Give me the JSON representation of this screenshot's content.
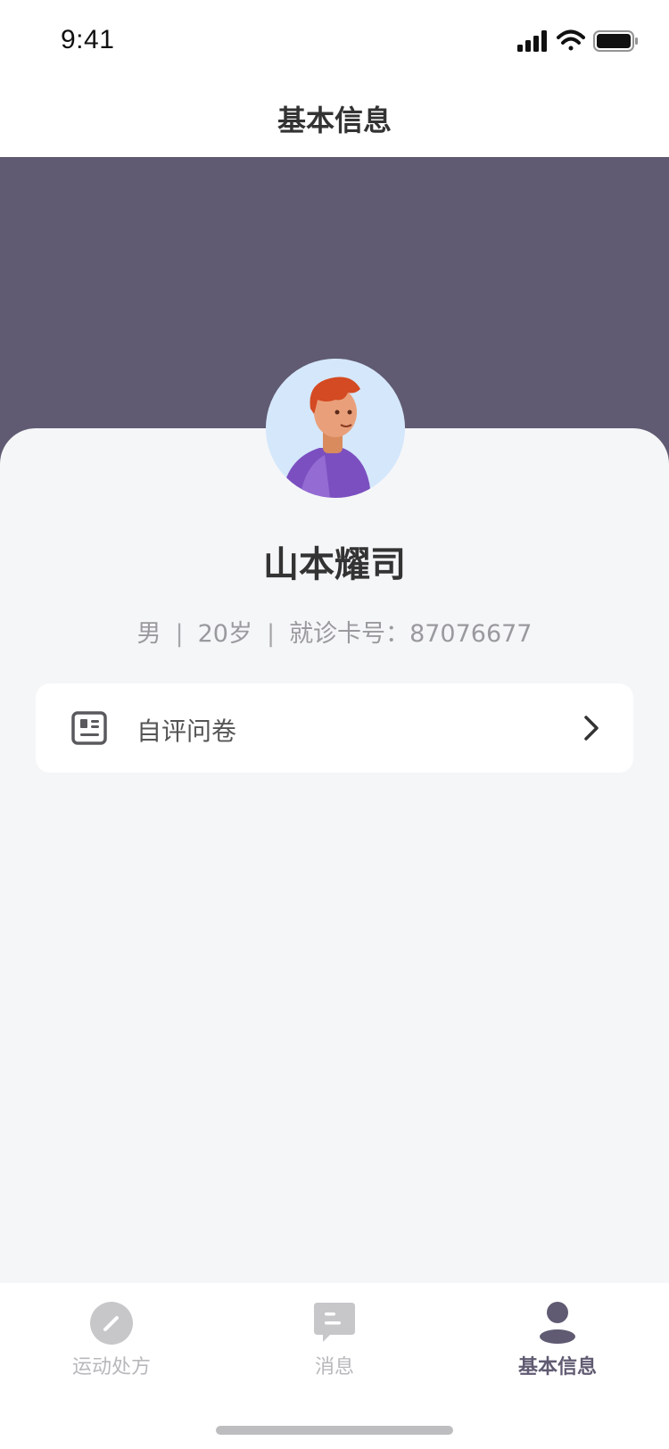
{
  "status_bar": {
    "time": "9:41"
  },
  "header": {
    "title": "基本信息"
  },
  "profile": {
    "name": "山本耀司",
    "gender": "男",
    "age": "20岁",
    "card_label": "就诊卡号：",
    "card_number": "87076677",
    "separator": "|"
  },
  "menu": [
    {
      "label": "自评问卷",
      "icon": "id-card-icon"
    }
  ],
  "tab_bar": {
    "items": [
      {
        "label": "运动处方",
        "icon": "pencil-icon",
        "active": false
      },
      {
        "label": "消息",
        "icon": "chat-icon",
        "active": false
      },
      {
        "label": "基本信息",
        "icon": "person-icon",
        "active": true
      }
    ]
  },
  "colors": {
    "accent": "#605B72",
    "background": "#F5F6F8",
    "inactive_tab": "#B8B8BC"
  }
}
